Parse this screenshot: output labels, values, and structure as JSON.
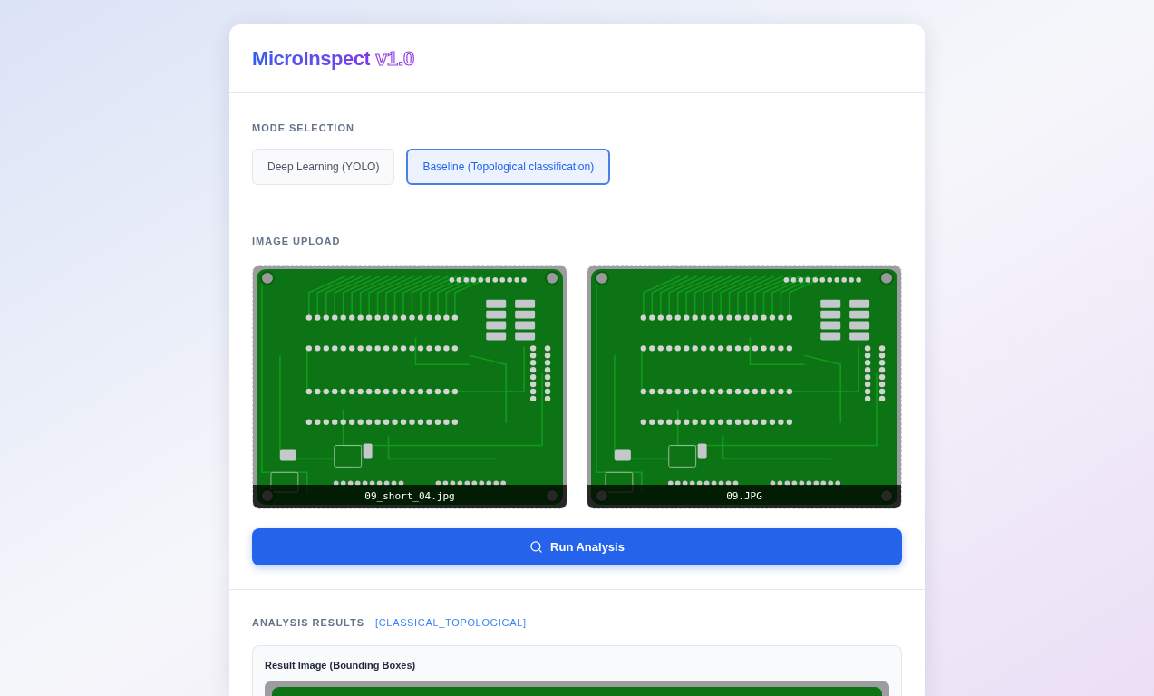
{
  "header": {
    "title": "MicroInspect",
    "version": "v1.0"
  },
  "mode_selection": {
    "label": "MODE SELECTION",
    "options": [
      {
        "label": "Deep Learning (YOLO)",
        "selected": false
      },
      {
        "label": "Baseline (Topological classification)",
        "selected": true
      }
    ]
  },
  "image_upload": {
    "label": "IMAGE UPLOAD",
    "images": [
      {
        "filename": "09_short_04.jpg"
      },
      {
        "filename": "09.JPG"
      }
    ],
    "run_button": "Run Analysis"
  },
  "analysis_results": {
    "label": "ANALYSIS RESULTS",
    "method": "[CLASSICAL_TOPOLOGICAL]",
    "result_card": {
      "title": "Result Image (Bounding Boxes)"
    }
  }
}
